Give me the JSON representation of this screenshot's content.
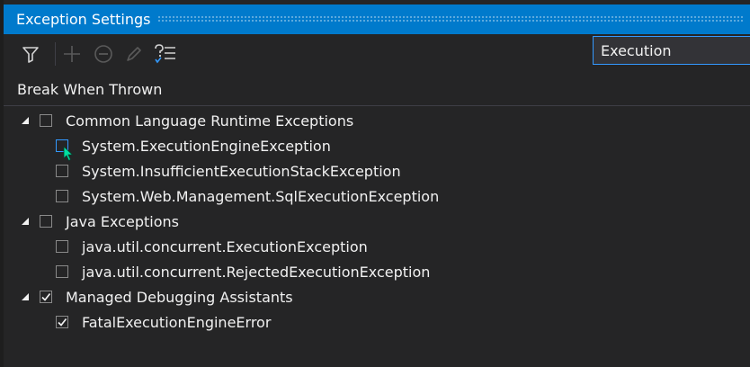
{
  "window": {
    "title": "Exception Settings"
  },
  "toolbar": {
    "buttons": [
      {
        "icon": "filter-icon",
        "enabled": true
      },
      {
        "icon": "add-icon",
        "enabled": false
      },
      {
        "icon": "remove-icon",
        "enabled": false
      },
      {
        "icon": "edit-conditions-icon",
        "enabled": false
      },
      {
        "icon": "restore-defaults-icon",
        "enabled": true
      }
    ]
  },
  "search": {
    "value": "Execution",
    "placeholder": ""
  },
  "list": {
    "header": "Break When Thrown",
    "groups": [
      {
        "label": "Common Language Runtime Exceptions",
        "checked": false,
        "expanded": true,
        "items": [
          {
            "label": "System.ExecutionEngineException",
            "checked": false,
            "focused": true
          },
          {
            "label": "System.InsufficientExecutionStackException",
            "checked": false
          },
          {
            "label": "System.Web.Management.SqlExecutionException",
            "checked": false
          }
        ]
      },
      {
        "label": "Java Exceptions",
        "checked": false,
        "expanded": true,
        "items": [
          {
            "label": "java.util.concurrent.ExecutionException",
            "checked": false
          },
          {
            "label": "java.util.concurrent.RejectedExecutionException",
            "checked": false
          }
        ]
      },
      {
        "label": "Managed Debugging Assistants",
        "checked": true,
        "expanded": true,
        "items": [
          {
            "label": "FatalExecutionEngineError",
            "checked": true
          }
        ]
      }
    ]
  },
  "colors": {
    "accent": "#007acc",
    "background": "#252526",
    "text": "#f1f1f1",
    "focus_border": "#3399ff",
    "disabled_icon": "#5a5a5a",
    "cursor": "#00e0a0"
  }
}
